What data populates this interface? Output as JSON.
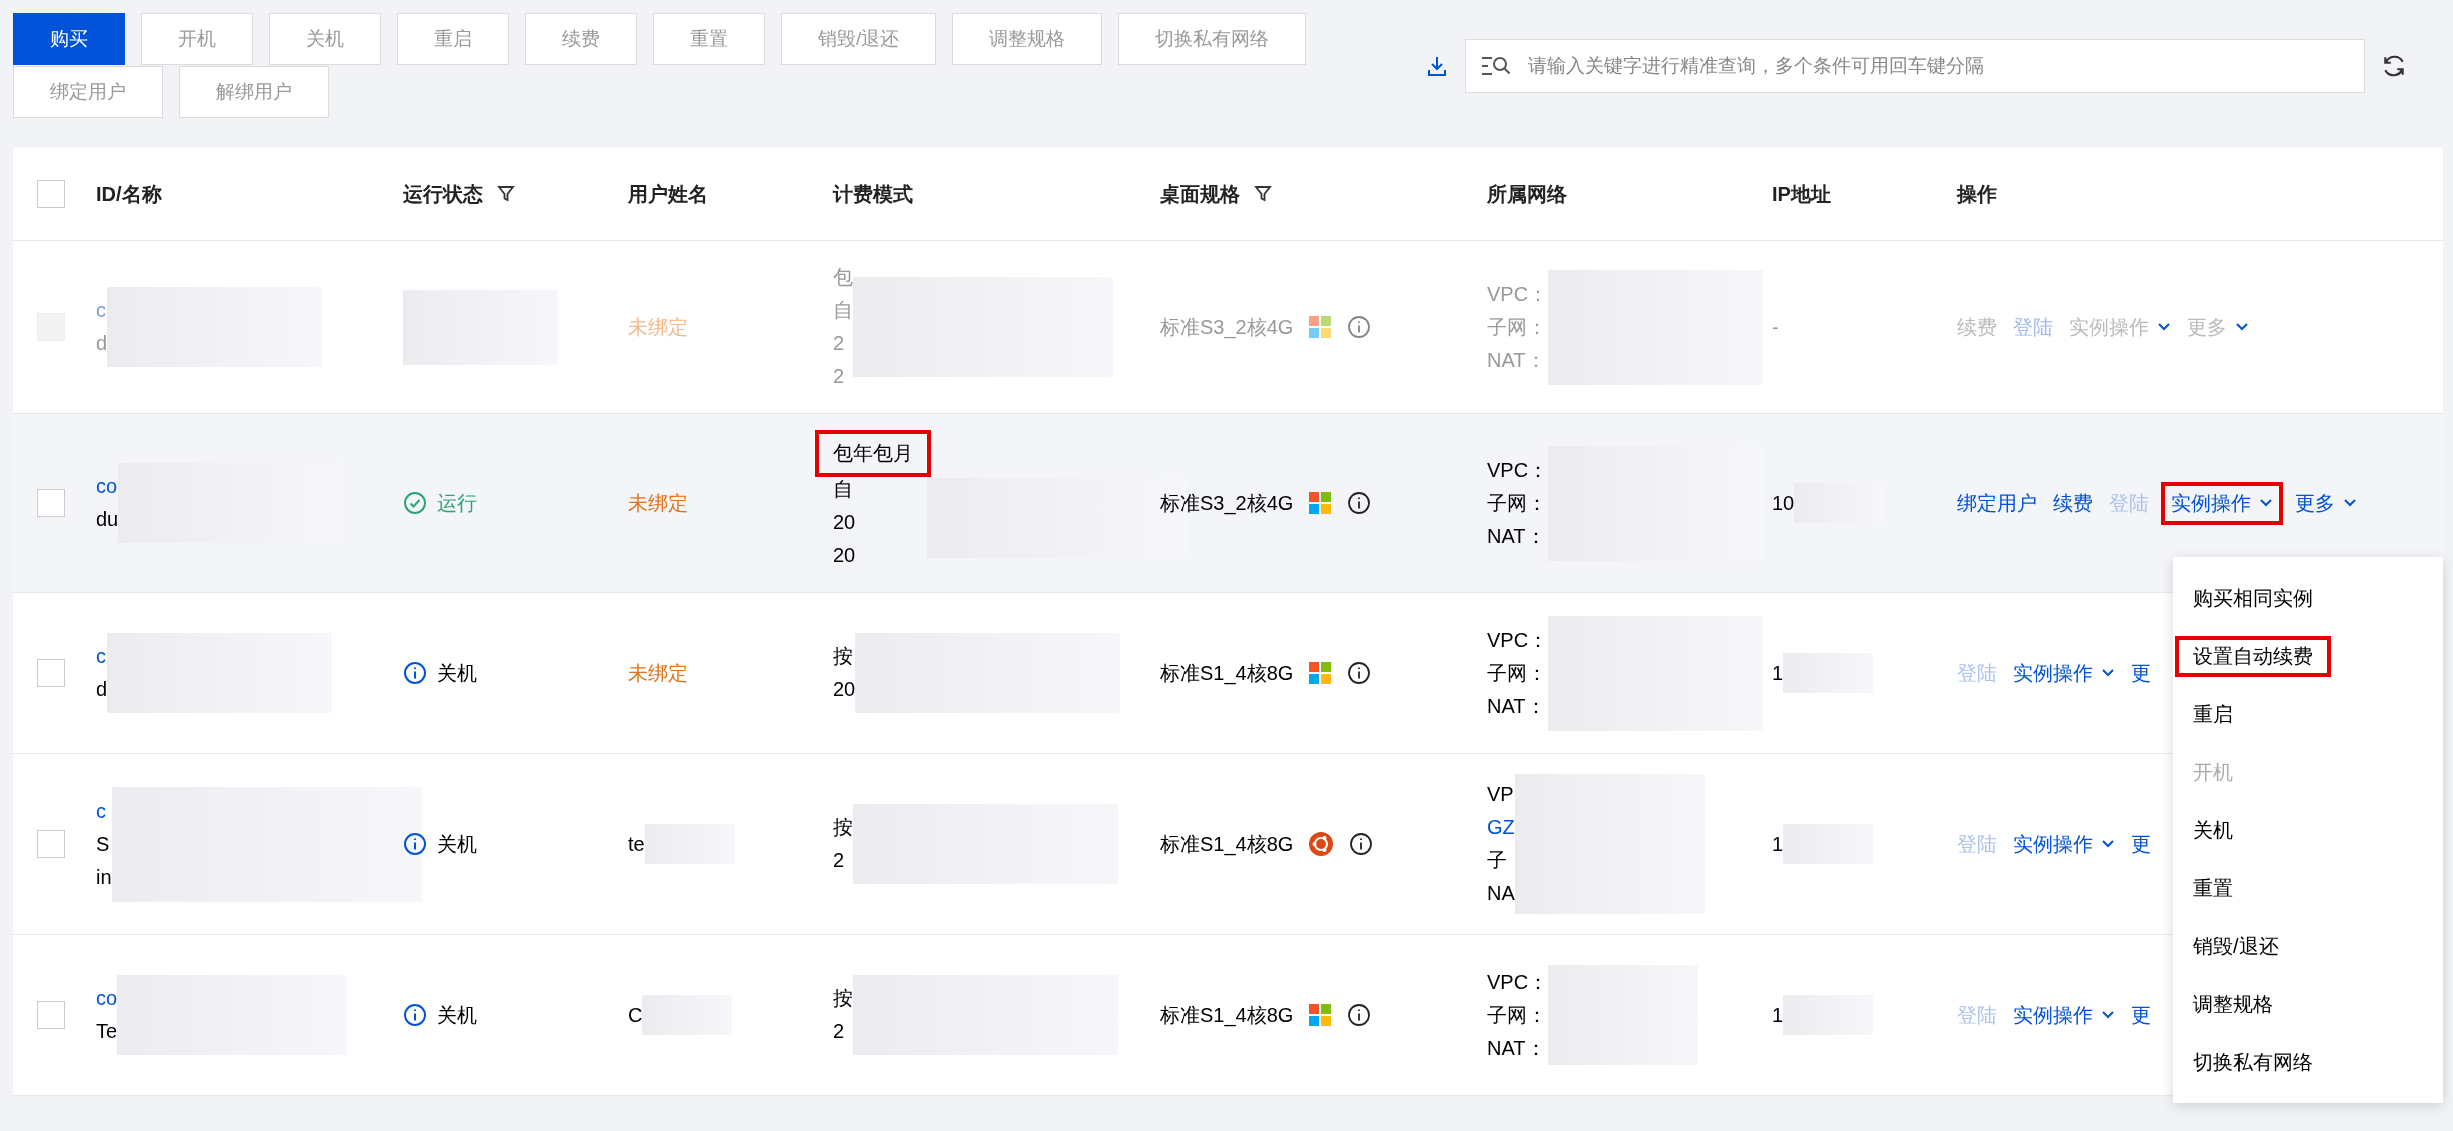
{
  "toolbar": [
    {
      "label": "购买",
      "primary": true,
      "disabled": false
    },
    {
      "label": "开机",
      "primary": false,
      "disabled": true
    },
    {
      "label": "关机",
      "primary": false,
      "disabled": true
    },
    {
      "label": "重启",
      "primary": false,
      "disabled": true
    },
    {
      "label": "续费",
      "primary": false,
      "disabled": true
    },
    {
      "label": "重置",
      "primary": false,
      "disabled": true
    },
    {
      "label": "销毁/退还",
      "primary": false,
      "disabled": true
    },
    {
      "label": "调整规格",
      "primary": false,
      "disabled": true
    },
    {
      "label": "切换私有网络",
      "primary": false,
      "disabled": true
    },
    {
      "label": "绑定用户",
      "primary": false,
      "disabled": true
    },
    {
      "label": "解绑用户",
      "primary": false,
      "disabled": true
    }
  ],
  "search": {
    "placeholder": "请输入关键字进行精准查询，多个条件可用回车键分隔"
  },
  "table": {
    "select_all_checked": false,
    "columns": [
      {
        "label": "ID/名称",
        "filter": false
      },
      {
        "label": "运行状态",
        "filter": true
      },
      {
        "label": "用户姓名",
        "filter": false
      },
      {
        "label": "计费模式",
        "filter": false
      },
      {
        "label": "桌面规格",
        "filter": true
      },
      {
        "label": "所属网络",
        "filter": false
      },
      {
        "label": "IP地址",
        "filter": false
      },
      {
        "label": "操作",
        "filter": false
      }
    ],
    "rows": [
      {
        "faded": true,
        "hovered": false,
        "id_lines": [
          "c",
          "d"
        ],
        "user": {
          "kind": "unbound",
          "text": "未绑定"
        },
        "billing": [
          "包",
          "自",
          "2",
          "2"
        ],
        "billing_highlighted": false,
        "spec": "标准S3_2核4G",
        "os": {
          "kind": "windows"
        },
        "network": [
          {
            "text": "VPC：",
            "kind": "text"
          },
          {
            "text": "子网：",
            "kind": "text"
          },
          {
            "text": "NAT：",
            "kind": "text"
          }
        ],
        "ip": "-",
        "actions": [
          {
            "label": "续费",
            "kind": "link",
            "disabled": false,
            "highlighted": false
          },
          {
            "label": "登陆",
            "kind": "link",
            "disabled": true,
            "highlighted": false
          },
          {
            "label": "实例操作",
            "kind": "dropdown",
            "disabled": false,
            "highlighted": false
          },
          {
            "label": "更多",
            "kind": "dropdown",
            "disabled": false,
            "highlighted": false
          }
        ]
      },
      {
        "faded": false,
        "hovered": true,
        "id_lines": [
          "co",
          "du"
        ],
        "status": {
          "kind": "running",
          "label": "运行"
        },
        "user": {
          "kind": "unbound",
          "text": "未绑定"
        },
        "billing": [
          "包年包月",
          "自",
          "20",
          "20"
        ],
        "billing_highlighted": true,
        "spec": "标准S3_2核4G",
        "os": {
          "kind": "windows"
        },
        "network": [
          {
            "text": "VPC：",
            "kind": "text"
          },
          {
            "text": "子网：",
            "kind": "text"
          },
          {
            "text": "NAT：",
            "kind": "text"
          }
        ],
        "ip": "10",
        "actions": [
          {
            "label": "绑定用户",
            "kind": "link",
            "disabled": false,
            "highlighted": false
          },
          {
            "label": "续费",
            "kind": "link",
            "disabled": false,
            "highlighted": false
          },
          {
            "label": "登陆",
            "kind": "link",
            "disabled": true,
            "highlighted": false
          },
          {
            "label": "实例操作",
            "kind": "dropdown",
            "disabled": false,
            "highlighted": true
          },
          {
            "label": "更多",
            "kind": "dropdown",
            "disabled": false,
            "highlighted": false
          }
        ]
      },
      {
        "faded": false,
        "hovered": false,
        "id_lines": [
          "c",
          "d"
        ],
        "status": {
          "kind": "stopped",
          "label": "关机"
        },
        "user": {
          "kind": "unbound",
          "text": "未绑定"
        },
        "billing": [
          "按",
          "20"
        ],
        "billing_highlighted": false,
        "spec": "标准S1_4核8G",
        "os": {
          "kind": "windows"
        },
        "network": [
          {
            "text": "VPC：",
            "kind": "text"
          },
          {
            "text": "子网：",
            "kind": "text"
          },
          {
            "text": "NAT：",
            "kind": "text"
          }
        ],
        "ip": "1",
        "actions": [
          {
            "label": "登陆",
            "kind": "link",
            "disabled": true,
            "highlighted": false
          },
          {
            "label": "实例操作",
            "kind": "dropdown",
            "disabled": false,
            "highlighted": false
          },
          {
            "label": "更",
            "kind": "link",
            "disabled": false,
            "highlighted": false
          }
        ]
      },
      {
        "faded": false,
        "hovered": false,
        "id_lines": [
          "c",
          "S",
          "in"
        ],
        "status": {
          "kind": "stopped",
          "label": "关机"
        },
        "user": {
          "kind": "name",
          "text": "te"
        },
        "billing": [
          "按",
          "2"
        ],
        "billing_highlighted": false,
        "spec": "标准S1_4核8G",
        "os": {
          "kind": "ubuntu"
        },
        "network": [
          {
            "text": "VP",
            "kind": "text"
          },
          {
            "text": "GZ",
            "kind": "link"
          },
          {
            "text": "子",
            "kind": "text"
          },
          {
            "text": "NA",
            "kind": "text"
          }
        ],
        "ip": "1",
        "actions": [
          {
            "label": "登陆",
            "kind": "link",
            "disabled": true,
            "highlighted": false
          },
          {
            "label": "实例操作",
            "kind": "dropdown",
            "disabled": false,
            "highlighted": false
          },
          {
            "label": "更",
            "kind": "link",
            "disabled": false,
            "highlighted": false
          }
        ]
      },
      {
        "faded": false,
        "hovered": false,
        "id_lines": [
          "co",
          "Te"
        ],
        "status": {
          "kind": "stopped",
          "label": "关机"
        },
        "user": {
          "kind": "name",
          "text": "C"
        },
        "billing": [
          "按",
          "2"
        ],
        "billing_highlighted": false,
        "spec": "标准S1_4核8G",
        "os": {
          "kind": "windows"
        },
        "network": [
          {
            "text": "VPC：",
            "kind": "text"
          },
          {
            "text": "子网：",
            "kind": "text"
          },
          {
            "text": "NAT：",
            "kind": "text"
          }
        ],
        "ip": "1",
        "actions": [
          {
            "label": "登陆",
            "kind": "link",
            "disabled": true,
            "highlighted": false
          },
          {
            "label": "实例操作",
            "kind": "dropdown",
            "disabled": false,
            "highlighted": false
          },
          {
            "label": "更",
            "kind": "link",
            "disabled": false,
            "highlighted": false
          }
        ]
      }
    ]
  },
  "menu": [
    {
      "label": "购买相同实例",
      "disabled": false,
      "highlighted": false
    },
    {
      "label": "设置自动续费",
      "disabled": false,
      "highlighted": true
    },
    {
      "label": "重启",
      "disabled": false,
      "highlighted": false
    },
    {
      "label": "开机",
      "disabled": true,
      "highlighted": false
    },
    {
      "label": "关机",
      "disabled": false,
      "highlighted": false
    },
    {
      "label": "重置",
      "disabled": false,
      "highlighted": false
    },
    {
      "label": "销毁/退还",
      "disabled": false,
      "highlighted": false
    },
    {
      "label": "调整规格",
      "disabled": false,
      "highlighted": false
    },
    {
      "label": "切换私有网络",
      "disabled": false,
      "highlighted": false
    }
  ]
}
